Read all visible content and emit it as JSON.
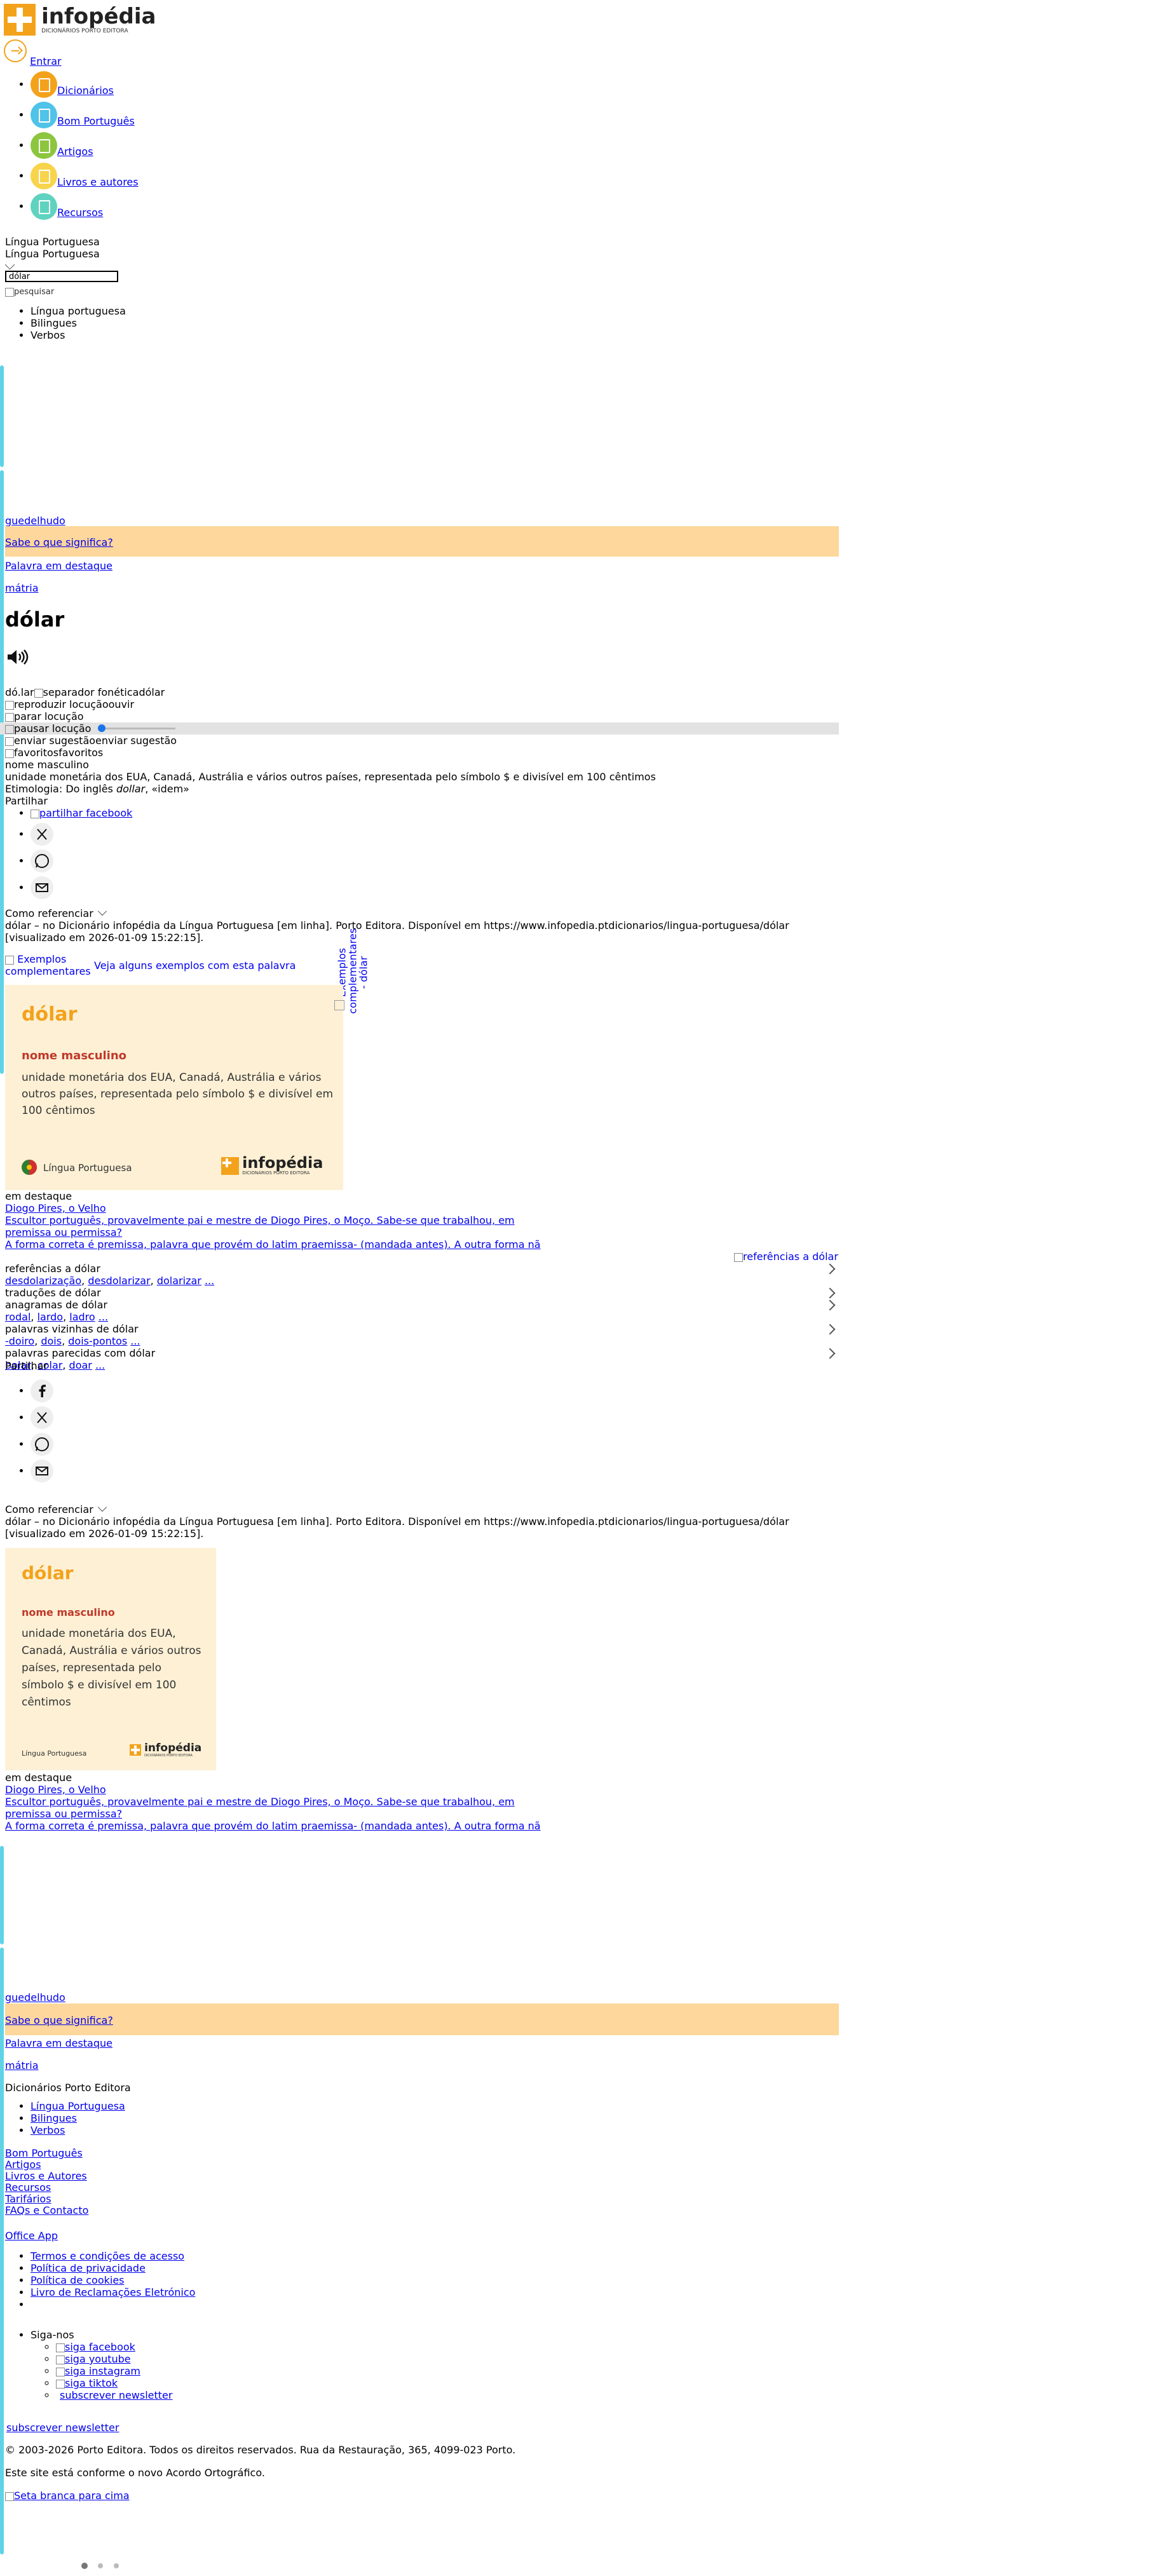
{
  "brand": {
    "name": "infopédia",
    "sub": "DICIONÁRIOS PORTO EDITORA"
  },
  "login": "Entrar",
  "nav": [
    {
      "label": "Dicionários",
      "color": "#f3a21c"
    },
    {
      "label": "Bom Português",
      "color": "#4fc3e8"
    },
    {
      "label": "Artigos",
      "color": "#8cc63f"
    },
    {
      "label": "Livros e autores",
      "color": "#f7d44c"
    },
    {
      "label": "Recursos",
      "color": "#5fd3c0"
    }
  ],
  "lang_select": {
    "value": "Língua Portuguesa",
    "value2": "Língua Portuguesa"
  },
  "search": {
    "value": "dólar",
    "button_alt": "pesquisar"
  },
  "search_tabs": [
    "Língua portuguesa",
    "Bilingues",
    "Verbos"
  ],
  "banner": {
    "word": "guedelhudo",
    "question": "Sabe o que significa?",
    "featured": "Palavra em destaque",
    "word2": "mátria"
  },
  "entry": {
    "headword": "dólar",
    "phonetic": "dó.lar",
    "phonetic_sep_alt": "separador fonética",
    "phonetic_word": "dólar",
    "play_alt": "reproduzir locução",
    "play_label": "ouvir",
    "stop_alt": "parar locução",
    "pause_alt": "pausar locução",
    "suggest_alt": "enviar sugestão",
    "suggest_label": "enviar sugestão",
    "fav_alt": "favoritos",
    "fav_label": "favoritos",
    "pos": "nome masculino",
    "definition": "unidade monetária dos EUA, Canadá, Austrália e vários outros países, representada pelo símbolo $ e divisível em 100 cêntimos",
    "etym_prefix": "Etimologia: Do inglês ",
    "etym_word": "dollar",
    "etym_suffix": ", «idem»"
  },
  "share": {
    "label": "Partilhar",
    "fb_alt": "partilhar facebook"
  },
  "cite": {
    "label": "Como referenciar",
    "text": "dólar – no Dicionário infopédia da Língua Portuguesa [em linha]. Porto Editora. Disponível em https://www.infopedia.ptdicionarios/lingua-portuguesa/dólar [visualizado em 2026-01-09 15:22:15]."
  },
  "examples": {
    "img_alt": "Exemplos complementares",
    "link": "Veja alguns exemplos com esta palavra",
    "vertical": "Exemplos complementares - dólar"
  },
  "card": {
    "word": "dólar",
    "pos": "nome masculino",
    "definition": "unidade monetária dos EUA, Canadá, Austrália e vários outros países, representada pelo símbolo $ e divisível em 100 cêntimos",
    "lang": "Língua Portuguesa",
    "brand": "infopédia",
    "brand_sub": "DICIONÁRIOS PORTO EDITORA"
  },
  "highlights": {
    "label": "em destaque",
    "items": [
      "Diogo Pires, o Velho",
      "Escultor português, provavelmente pai e mestre de Diogo Pires, o Moço. Sabe-se que trabalhou, em",
      "premissa ou permissa?",
      "A forma correta é premissa, palavra que provém do latim praemissa- (mandada antes). A outra forma nã"
    ]
  },
  "refs_alt": "referências a dólar",
  "sections": [
    {
      "title": "referências a dólar",
      "items": [
        "desdolarização",
        "desdolarizar",
        "dolarizar",
        "..."
      ]
    },
    {
      "title": "traduções de dólar",
      "items": []
    },
    {
      "title": "anagramas de dólar",
      "items": [
        "rodal",
        "lardo",
        "ladro",
        "..."
      ]
    },
    {
      "title": "palavras vizinhas de dólar",
      "items": [
        "-doiro",
        "dois",
        "dois-pontos",
        "..."
      ]
    },
    {
      "title": "palavras parecidas com dólar",
      "items": [
        "bolar",
        "colar",
        "doar",
        "..."
      ]
    }
  ],
  "footer": {
    "title": "Dicionários Porto Editora",
    "dict_links": [
      "Língua Portuguesa",
      "Bilingues",
      "Verbos"
    ],
    "links": [
      "Bom Português",
      "Artigos",
      "Livros e Autores",
      "Recursos",
      "Tarifários",
      "FAQs e Contacto"
    ],
    "office": "Office App",
    "legal": [
      "Termos e condições de acesso",
      "Política de privacidade",
      "Política de cookies",
      "Livro de Reclamações Eletrónico"
    ],
    "follow": "Siga-nos",
    "social": [
      "siga facebook",
      "siga youtube",
      "siga instagram",
      "siga tiktok"
    ],
    "newsletter": "subscrever newsletter",
    "newsletter2": "subscrever newsletter",
    "copyright": "© 2003-2026 Porto Editora. Todos os direitos reservados. Rua da Restauração, 365, 4099-023 Porto.",
    "ao": "Este site está conforme o novo Acordo Ortográfico.",
    "top_alt": "Seta branca para cima"
  },
  "colors": {
    "banner": "#fdd79b",
    "card": "#fdf0d5",
    "accent": "#f3a21c",
    "cyan": "#5fd3e6",
    "pos": "#c0392b"
  }
}
